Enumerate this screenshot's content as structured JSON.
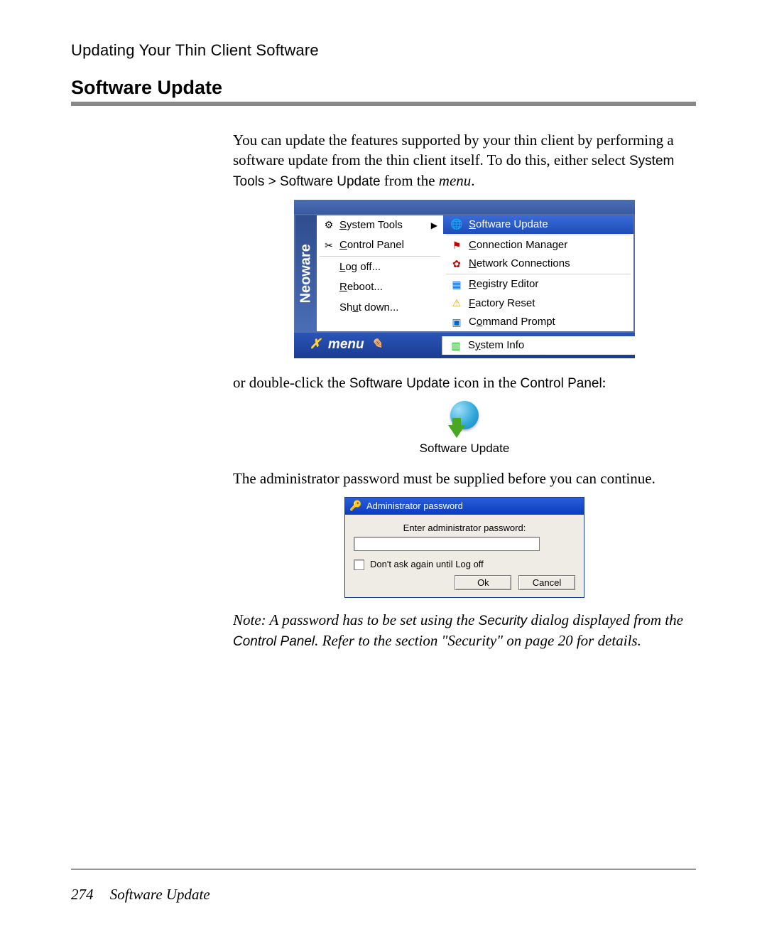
{
  "header": {
    "chapter": "Updating Your Thin Client Software",
    "section_title": "Software Update"
  },
  "para1": {
    "pre": "You can update the features supported by your thin client by performing a software update from the thin client itself. To do this, either select ",
    "path": "System Tools > Software Update",
    "mid": " from the ",
    "menu_word": "menu",
    "post": "."
  },
  "menushot": {
    "brand": "Neoware",
    "left": {
      "system_tools": "System Tools",
      "control_panel": "Control Panel",
      "log_off": "Log off...",
      "reboot": "Reboot...",
      "shut_down": "Shut down..."
    },
    "right": {
      "software_update": "Software Update",
      "connection_manager": "Connection Manager",
      "network_connections": "Network Connections",
      "registry_editor": "Registry Editor",
      "factory_reset": "Factory Reset",
      "command_prompt": "Command Prompt",
      "system_info": "System Info"
    },
    "footer_label": "menu"
  },
  "para2": {
    "pre": "or double-click the ",
    "icon_name": "Software Update",
    "mid": " icon in the ",
    "panel_name": "Control Panel",
    "post": ":"
  },
  "su_icon_caption": "Software Update",
  "para3": "The administrator password must be supplied before you can continue.",
  "dialog": {
    "title": "Administrator password",
    "label": "Enter administrator password:",
    "checkbox_label": "Don't ask again until Log off",
    "ok": "Ok",
    "cancel": "Cancel"
  },
  "note": {
    "pre": "Note:  A password has to be set using the ",
    "sec": "Security",
    "mid1": " dialog displayed from the ",
    "cp": "Control Panel",
    "mid2": ". Refer to the section \"Security\" on page 20 for details."
  },
  "footer": {
    "page_number": "274",
    "title": "Software Update"
  }
}
